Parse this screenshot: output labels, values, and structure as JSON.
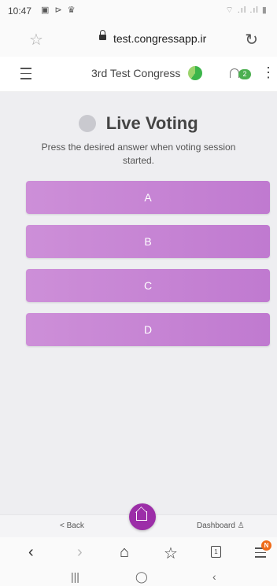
{
  "status_bar": {
    "time": "10:47",
    "left_icons": "▣ ⊳ ♛",
    "right_icons": "⌔ .ıl .ıl ▮"
  },
  "url_bar": {
    "url": "test.congressapp.ir"
  },
  "app_header": {
    "title": "3rd Test Congress",
    "notification_count": "2"
  },
  "voting": {
    "title": "Live Voting",
    "instructions": "Press the desired answer when voting session started.",
    "options": [
      "A",
      "B",
      "C",
      "D"
    ]
  },
  "bottom_nav": {
    "back_label": "< Back",
    "dashboard_label": "Dashboard ♙"
  },
  "browser_nav": {
    "tab_count": "1",
    "menu_badge": "N"
  },
  "icons": {
    "star": "star-icon",
    "lock": "lock-icon",
    "reload": "reload-icon",
    "hamburger": "hamburger-icon",
    "logo": "congress-logo-icon",
    "bell": "bell-icon",
    "kebab": "kebab-menu-icon",
    "home": "home-icon"
  },
  "colors": {
    "option_button": "#c584d4",
    "home_fab": "#9c2ea8",
    "badge_green": "#4caf50",
    "menu_badge": "#ef6c1a",
    "content_bg": "#eeeef1"
  }
}
